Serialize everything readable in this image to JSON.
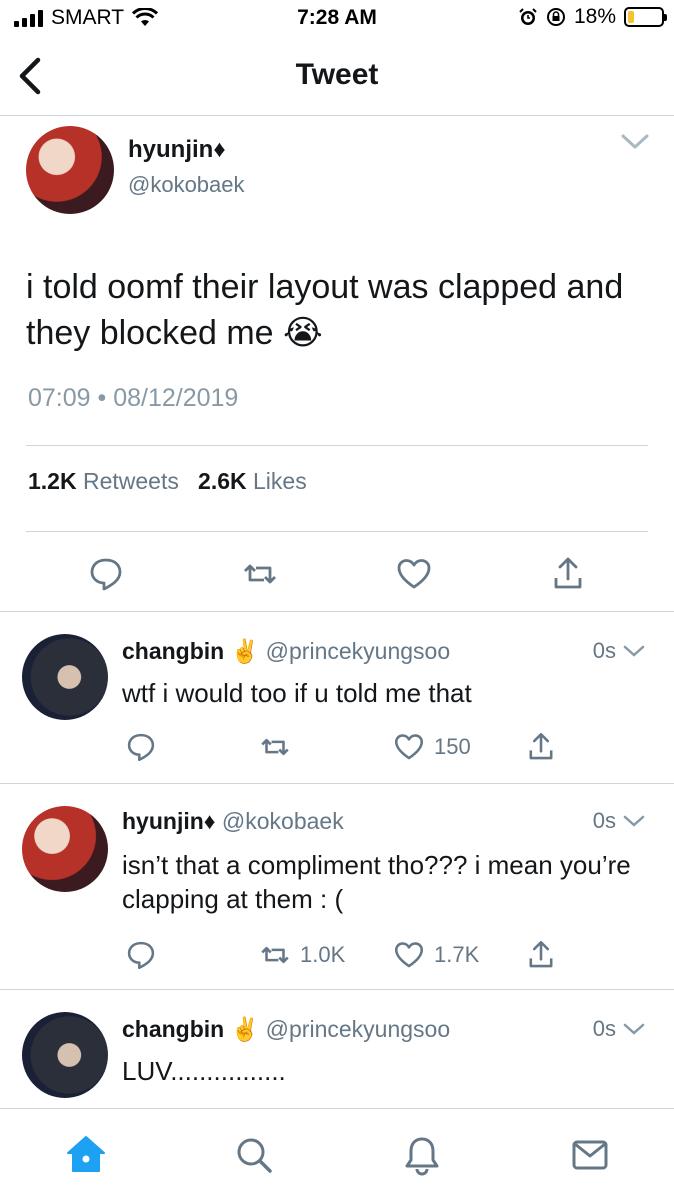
{
  "status_bar": {
    "carrier": "SMART",
    "time": "7:28 AM",
    "battery_percent": "18%",
    "battery_level": 0.18
  },
  "nav": {
    "title": "Tweet"
  },
  "main_tweet": {
    "name": "hyunjin♦",
    "handle": "@kokobaek",
    "text": "i told oomf their layout was clapped and they blocked me 😭",
    "timestamp": "07:09 • 08/12/2019",
    "retweets_count": "1.2K",
    "retweets_label": "Retweets",
    "likes_count": "2.6K",
    "likes_label": "Likes"
  },
  "replies": [
    {
      "name": "changbin",
      "emoji": "✌️",
      "handle": "@princekyungsoo",
      "time": "0s",
      "text": "wtf i would too if u told me that",
      "retweets": "",
      "likes": "150"
    },
    {
      "name": "hyunjin♦",
      "emoji": "",
      "handle": "@kokobaek",
      "time": "0s",
      "text": "isn’t that a compliment tho??? i mean you’re clapping at them : (",
      "retweets": "1.0K",
      "likes": "1.7K"
    },
    {
      "name": "changbin",
      "emoji": "✌️",
      "handle": "@princekyungsoo",
      "time": "0s",
      "text": "LUV................",
      "retweets": "",
      "likes": ""
    }
  ],
  "colors": {
    "accent": "#1da1f2",
    "secondary_text": "#657786",
    "divider": "#cfd5da"
  },
  "icons": [
    "back-icon",
    "chevron-down-icon",
    "reply-icon",
    "retweet-icon",
    "like-icon",
    "share-icon",
    "home-icon",
    "search-icon",
    "notifications-icon",
    "messages-icon",
    "wifi-icon",
    "alarm-icon",
    "lock-rotation-icon",
    "battery-icon"
  ]
}
